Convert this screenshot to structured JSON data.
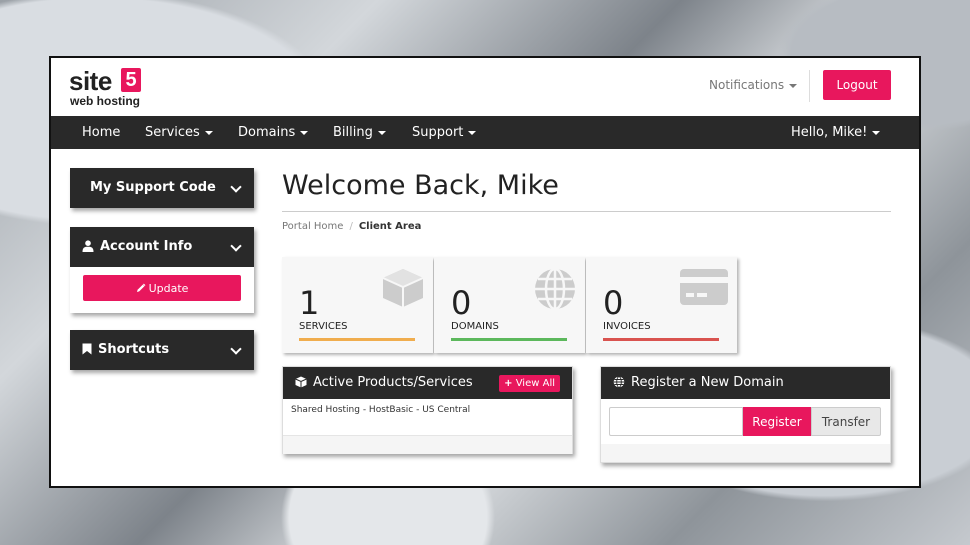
{
  "brand": {
    "logo_main": "site",
    "logo_number": "5",
    "logo_sub": "web hosting",
    "accent_color": "#e8175d",
    "dark_color": "#292929"
  },
  "header": {
    "notifications_label": "Notifications",
    "logout_label": "Logout"
  },
  "nav": {
    "items": [
      {
        "label": "Home"
      },
      {
        "label": "Services"
      },
      {
        "label": "Domains"
      },
      {
        "label": "Billing"
      },
      {
        "label": "Support"
      }
    ],
    "user_label": "Hello, Mike!"
  },
  "sidebar": {
    "support_code_title": "My Support Code",
    "account_info_title": "Account Info",
    "update_label": "Update",
    "shortcuts_title": "Shortcuts"
  },
  "main": {
    "title": "Welcome Back, Mike",
    "breadcrumb": {
      "home": "Portal Home",
      "current": "Client Area"
    },
    "stats": [
      {
        "value": "1",
        "label": "SERVICES",
        "color": "#f0ad4e",
        "icon": "cube-icon"
      },
      {
        "value": "0",
        "label": "DOMAINS",
        "color": "#5cb85c",
        "icon": "globe-icon"
      },
      {
        "value": "0",
        "label": "INVOICES",
        "color": "#d9534f",
        "icon": "credit-card-icon"
      }
    ],
    "products_panel": {
      "title": "Active Products/Services",
      "view_all_label": "View All",
      "rows": [
        "Shared Hosting - HostBasic - US Central"
      ]
    },
    "domain_panel": {
      "title": "Register a New Domain",
      "input_placeholder": "",
      "register_label": "Register",
      "transfer_label": "Transfer"
    }
  }
}
